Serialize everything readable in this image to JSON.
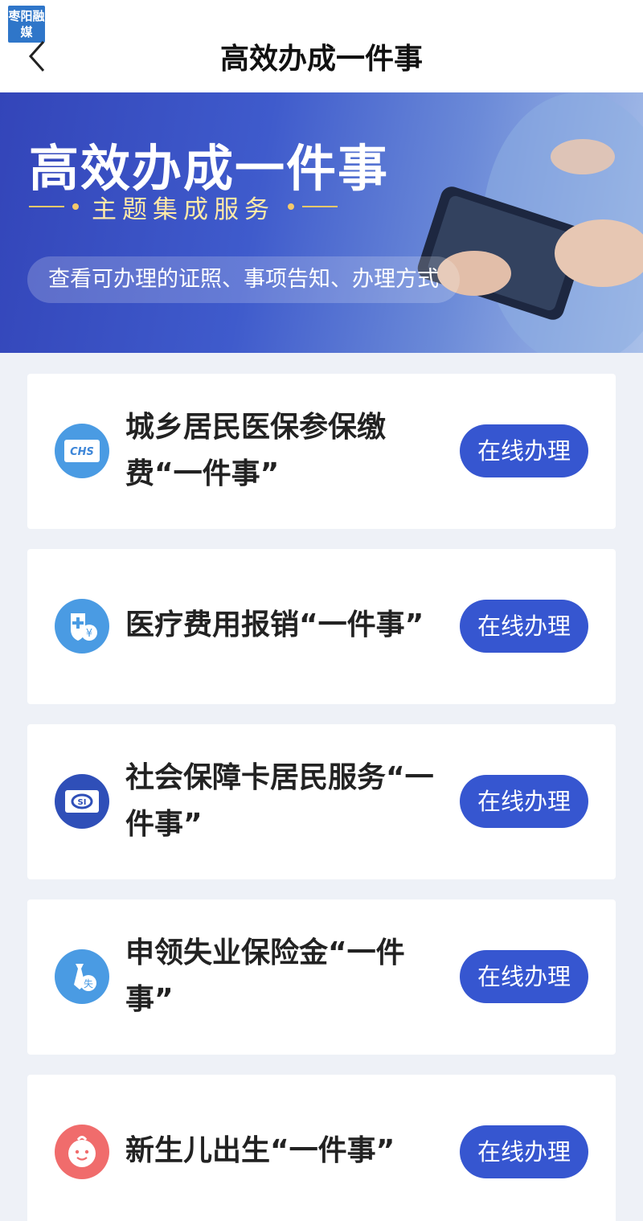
{
  "header": {
    "logo_text": "枣阳融媒",
    "title": "高效办成一件事"
  },
  "banner": {
    "title": "高效办成一件事",
    "subtitle": "主题集成服务",
    "pill_text": "查看可办理的证照、事项告知、办理方式"
  },
  "services": [
    {
      "title": "城乡居民医保参保缴费“一件事”",
      "icon": "chs-medical-insurance-icon",
      "button": "在线办理"
    },
    {
      "title": "医疗费用报销“一件事”",
      "icon": "medical-reimbursement-icon",
      "button": "在线办理"
    },
    {
      "title": "社会保障卡居民服务“一件事”",
      "icon": "social-security-card-icon",
      "button": "在线办理"
    },
    {
      "title": "申领失业保险金“一件事”",
      "icon": "unemployment-insurance-icon",
      "button": "在线办理"
    },
    {
      "title": "新生儿出生“一件事”",
      "icon": "newborn-icon",
      "button": "在线办理"
    }
  ],
  "colors": {
    "accent": "#3656d0",
    "banner_start": "#3345b9",
    "icon_blue": "#4a9be3",
    "icon_navy": "#2f4fb8",
    "icon_pink": "#f06c6c"
  }
}
